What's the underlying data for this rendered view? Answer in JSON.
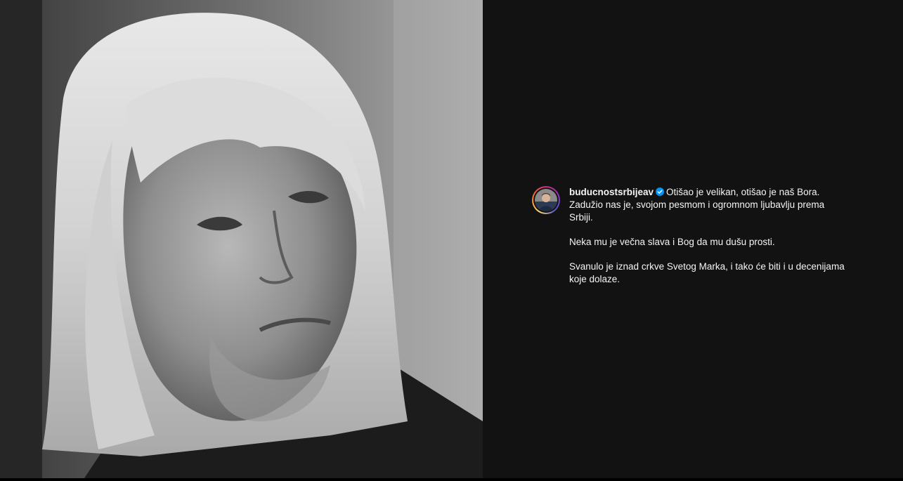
{
  "post": {
    "photo": {
      "subject": "black-and-white portrait photo"
    },
    "author": {
      "username": "buducnostsrbijeav",
      "verified": true,
      "avatar_icon": "profile-avatar",
      "ring_colors": [
        "#feda75",
        "#fa7e1e",
        "#d62976",
        "#962fbf",
        "#4f5bd5"
      ],
      "verified_color": "#0095f6"
    },
    "caption": {
      "first": "Otišao je velikan, otišao je naš Bora. Zadužio nas je, svojom pesmom i ogromnom ljubavlju prema Srbiji.",
      "second": "Neka mu je večna slava i Bog da mu dušu prosti.",
      "third": "Svanulo je iznad crkve Svetog Marka, i tako će biti i u decenijama koje dolaze."
    }
  },
  "colors": {
    "panel_bg": "#121212",
    "text": "#f5f5f5"
  }
}
